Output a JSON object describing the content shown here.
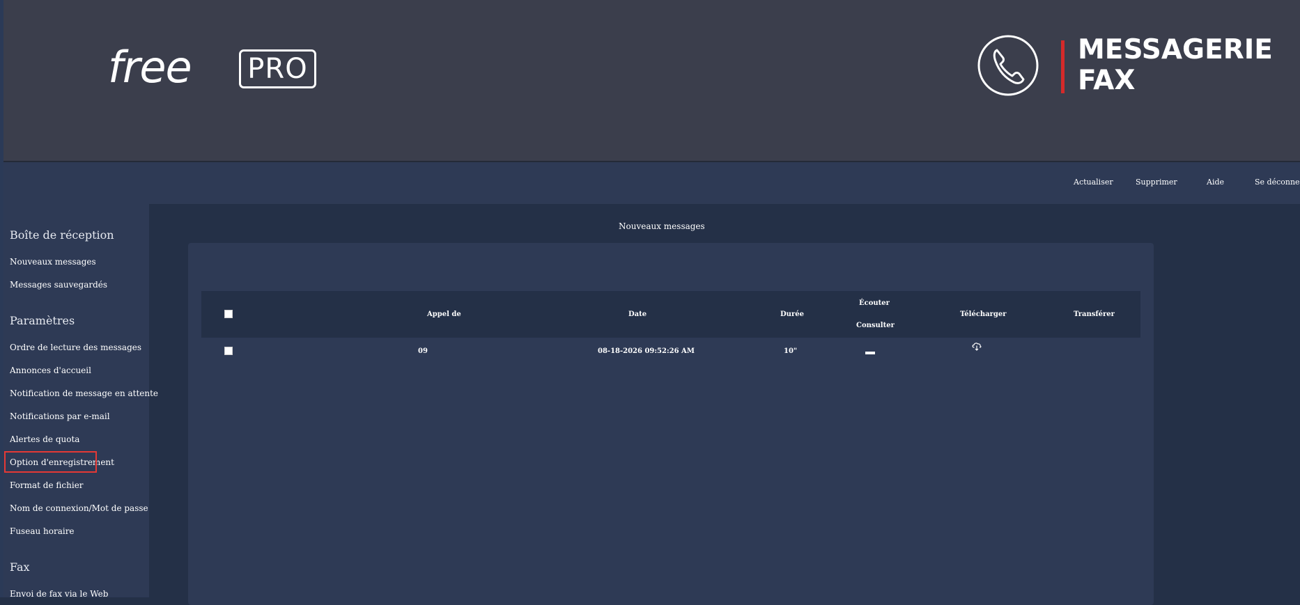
{
  "header": {
    "logo_free": "free",
    "logo_pro": "PRO",
    "brand_title": "MESSAGERIE\nFAX",
    "brand_accent": "#d42a2a"
  },
  "toolbar": {
    "refresh": "Actualiser",
    "delete": "Supprimer",
    "help": "Aide",
    "logout": "Se déconnecter"
  },
  "sidebar": {
    "inbox_heading": "Boîte de réception",
    "inbox_items": [
      "Nouveaux messages",
      "Messages sauvegardés"
    ],
    "settings_heading": "Paramètres",
    "settings_items": [
      "Ordre de lecture des messages",
      "Annonces d'accueil",
      "Notification de message en attente",
      "Notifications par e-mail",
      "Alertes de quota",
      "Option d'enregistrement",
      "Format de fichier",
      "Nom de connexion/Mot de passe",
      "Fuseau horaire"
    ],
    "fax_heading": "Fax",
    "fax_items": [
      "Envoi de fax via le Web"
    ]
  },
  "main": {
    "title": "Nouveaux messages",
    "columns": {
      "caller": "Appel de",
      "date": "Date",
      "duration": "Durée",
      "listen": "Écouter",
      "view": "Consulter",
      "download": "Télécharger",
      "forward": "Transférer"
    },
    "rows": [
      {
        "caller": "09",
        "date": "08-18-2026 09:52:26 AM",
        "duration": "10\""
      }
    ]
  }
}
